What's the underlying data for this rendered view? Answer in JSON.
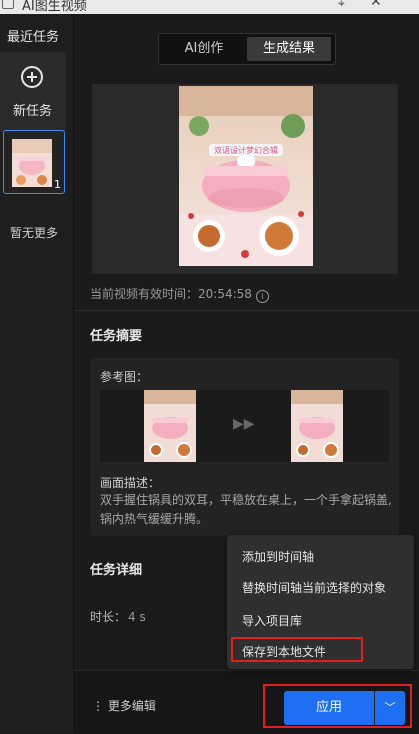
{
  "window": {
    "title": "AI图生视频"
  },
  "sidebar": {
    "header": "最近任务",
    "new_task": "新任务",
    "task_count": "1",
    "no_more": "暂无更多"
  },
  "tabs": [
    {
      "label": "AI创作"
    },
    {
      "label": "生成结果"
    }
  ],
  "preview": {
    "banner_text": "双语设计梦幻合辑",
    "valid_time": "当前视频有效时间：20:54:58",
    "info_icon": "i"
  },
  "summary": {
    "title": "任务摘要",
    "ref_label": "参考图：",
    "desc_label": "画面描述：",
    "desc_text": "双手握住锅具的双耳，平稳放在桌上，一个手拿起锅盖,锅内热气缓缓升腾。"
  },
  "detail": {
    "title": "任务详细",
    "duration_label": "时长：",
    "duration_value": "4 s"
  },
  "menu": {
    "items": [
      {
        "label": "添加到时间轴"
      },
      {
        "label": "替换时间轴当前选择的对象"
      },
      {
        "label": "导入项目库"
      },
      {
        "label": "保存到本地文件"
      }
    ]
  },
  "footer": {
    "more_edit": "更多编辑",
    "apply": "应用"
  },
  "colors": {
    "accent": "#1f6ff2",
    "highlight": "#e02020"
  }
}
